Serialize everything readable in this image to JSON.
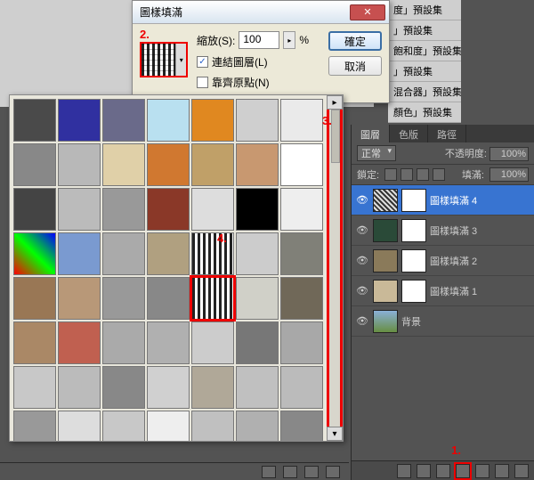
{
  "dialog": {
    "title": "圖樣填滿",
    "scale_label": "縮放(S):",
    "scale_value": "100",
    "scale_unit": "%",
    "link_label": "連結圖層(L)",
    "snap_label": "靠齊原點(N)",
    "ok": "確定",
    "cancel": "取消"
  },
  "annotations": {
    "a1": "1.",
    "a2": "2.",
    "a3": "3.",
    "a4": "4."
  },
  "presets": {
    "items": [
      "度」預設集",
      "」預設集",
      "飽和度」預設集",
      "」預設集",
      "混合器」預設集",
      "顏色」預設集"
    ]
  },
  "layers_panel": {
    "tabs": [
      "圖層",
      "色版",
      "路徑"
    ],
    "blend_mode": "正常",
    "opacity_label": "不透明度:",
    "opacity_value": "100%",
    "lock_label": "鎖定:",
    "fill_label": "填滿:",
    "fill_value": "100%",
    "layers": [
      {
        "name": "圖樣填滿 4",
        "selected": true,
        "thumb": "pat1",
        "mask": true
      },
      {
        "name": "圖樣填滿 3",
        "selected": false,
        "thumb": "pat2",
        "mask": true
      },
      {
        "name": "圖樣填滿 2",
        "selected": false,
        "thumb": "pat3",
        "mask": true
      },
      {
        "name": "圖樣填滿 1",
        "selected": false,
        "thumb": "pat4",
        "mask": true
      },
      {
        "name": "背景",
        "selected": false,
        "thumb": "bg",
        "mask": false
      }
    ]
  },
  "pattern_grid": {
    "rows": 8,
    "cols": 7,
    "highlight_index": 32
  }
}
